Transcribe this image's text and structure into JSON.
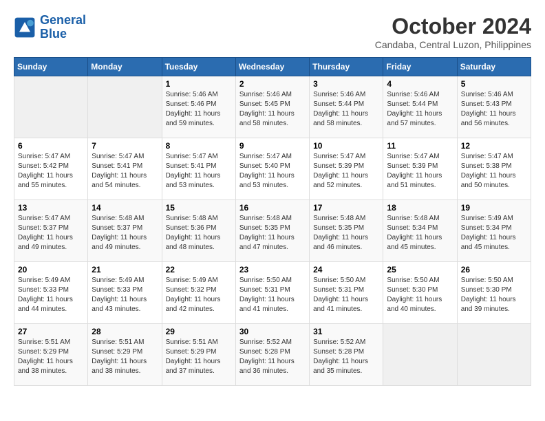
{
  "logo": {
    "line1": "General",
    "line2": "Blue"
  },
  "title": "October 2024",
  "location": "Candaba, Central Luzon, Philippines",
  "days_header": [
    "Sunday",
    "Monday",
    "Tuesday",
    "Wednesday",
    "Thursday",
    "Friday",
    "Saturday"
  ],
  "weeks": [
    [
      {
        "day": "",
        "sunrise": "",
        "sunset": "",
        "daylight": ""
      },
      {
        "day": "",
        "sunrise": "",
        "sunset": "",
        "daylight": ""
      },
      {
        "day": "1",
        "sunrise": "Sunrise: 5:46 AM",
        "sunset": "Sunset: 5:46 PM",
        "daylight": "Daylight: 11 hours and 59 minutes."
      },
      {
        "day": "2",
        "sunrise": "Sunrise: 5:46 AM",
        "sunset": "Sunset: 5:45 PM",
        "daylight": "Daylight: 11 hours and 58 minutes."
      },
      {
        "day": "3",
        "sunrise": "Sunrise: 5:46 AM",
        "sunset": "Sunset: 5:44 PM",
        "daylight": "Daylight: 11 hours and 58 minutes."
      },
      {
        "day": "4",
        "sunrise": "Sunrise: 5:46 AM",
        "sunset": "Sunset: 5:44 PM",
        "daylight": "Daylight: 11 hours and 57 minutes."
      },
      {
        "day": "5",
        "sunrise": "Sunrise: 5:46 AM",
        "sunset": "Sunset: 5:43 PM",
        "daylight": "Daylight: 11 hours and 56 minutes."
      }
    ],
    [
      {
        "day": "6",
        "sunrise": "Sunrise: 5:47 AM",
        "sunset": "Sunset: 5:42 PM",
        "daylight": "Daylight: 11 hours and 55 minutes."
      },
      {
        "day": "7",
        "sunrise": "Sunrise: 5:47 AM",
        "sunset": "Sunset: 5:41 PM",
        "daylight": "Daylight: 11 hours and 54 minutes."
      },
      {
        "day": "8",
        "sunrise": "Sunrise: 5:47 AM",
        "sunset": "Sunset: 5:41 PM",
        "daylight": "Daylight: 11 hours and 53 minutes."
      },
      {
        "day": "9",
        "sunrise": "Sunrise: 5:47 AM",
        "sunset": "Sunset: 5:40 PM",
        "daylight": "Daylight: 11 hours and 53 minutes."
      },
      {
        "day": "10",
        "sunrise": "Sunrise: 5:47 AM",
        "sunset": "Sunset: 5:39 PM",
        "daylight": "Daylight: 11 hours and 52 minutes."
      },
      {
        "day": "11",
        "sunrise": "Sunrise: 5:47 AM",
        "sunset": "Sunset: 5:39 PM",
        "daylight": "Daylight: 11 hours and 51 minutes."
      },
      {
        "day": "12",
        "sunrise": "Sunrise: 5:47 AM",
        "sunset": "Sunset: 5:38 PM",
        "daylight": "Daylight: 11 hours and 50 minutes."
      }
    ],
    [
      {
        "day": "13",
        "sunrise": "Sunrise: 5:47 AM",
        "sunset": "Sunset: 5:37 PM",
        "daylight": "Daylight: 11 hours and 49 minutes."
      },
      {
        "day": "14",
        "sunrise": "Sunrise: 5:48 AM",
        "sunset": "Sunset: 5:37 PM",
        "daylight": "Daylight: 11 hours and 49 minutes."
      },
      {
        "day": "15",
        "sunrise": "Sunrise: 5:48 AM",
        "sunset": "Sunset: 5:36 PM",
        "daylight": "Daylight: 11 hours and 48 minutes."
      },
      {
        "day": "16",
        "sunrise": "Sunrise: 5:48 AM",
        "sunset": "Sunset: 5:35 PM",
        "daylight": "Daylight: 11 hours and 47 minutes."
      },
      {
        "day": "17",
        "sunrise": "Sunrise: 5:48 AM",
        "sunset": "Sunset: 5:35 PM",
        "daylight": "Daylight: 11 hours and 46 minutes."
      },
      {
        "day": "18",
        "sunrise": "Sunrise: 5:48 AM",
        "sunset": "Sunset: 5:34 PM",
        "daylight": "Daylight: 11 hours and 45 minutes."
      },
      {
        "day": "19",
        "sunrise": "Sunrise: 5:49 AM",
        "sunset": "Sunset: 5:34 PM",
        "daylight": "Daylight: 11 hours and 45 minutes."
      }
    ],
    [
      {
        "day": "20",
        "sunrise": "Sunrise: 5:49 AM",
        "sunset": "Sunset: 5:33 PM",
        "daylight": "Daylight: 11 hours and 44 minutes."
      },
      {
        "day": "21",
        "sunrise": "Sunrise: 5:49 AM",
        "sunset": "Sunset: 5:33 PM",
        "daylight": "Daylight: 11 hours and 43 minutes."
      },
      {
        "day": "22",
        "sunrise": "Sunrise: 5:49 AM",
        "sunset": "Sunset: 5:32 PM",
        "daylight": "Daylight: 11 hours and 42 minutes."
      },
      {
        "day": "23",
        "sunrise": "Sunrise: 5:50 AM",
        "sunset": "Sunset: 5:31 PM",
        "daylight": "Daylight: 11 hours and 41 minutes."
      },
      {
        "day": "24",
        "sunrise": "Sunrise: 5:50 AM",
        "sunset": "Sunset: 5:31 PM",
        "daylight": "Daylight: 11 hours and 41 minutes."
      },
      {
        "day": "25",
        "sunrise": "Sunrise: 5:50 AM",
        "sunset": "Sunset: 5:30 PM",
        "daylight": "Daylight: 11 hours and 40 minutes."
      },
      {
        "day": "26",
        "sunrise": "Sunrise: 5:50 AM",
        "sunset": "Sunset: 5:30 PM",
        "daylight": "Daylight: 11 hours and 39 minutes."
      }
    ],
    [
      {
        "day": "27",
        "sunrise": "Sunrise: 5:51 AM",
        "sunset": "Sunset: 5:29 PM",
        "daylight": "Daylight: 11 hours and 38 minutes."
      },
      {
        "day": "28",
        "sunrise": "Sunrise: 5:51 AM",
        "sunset": "Sunset: 5:29 PM",
        "daylight": "Daylight: 11 hours and 38 minutes."
      },
      {
        "day": "29",
        "sunrise": "Sunrise: 5:51 AM",
        "sunset": "Sunset: 5:29 PM",
        "daylight": "Daylight: 11 hours and 37 minutes."
      },
      {
        "day": "30",
        "sunrise": "Sunrise: 5:52 AM",
        "sunset": "Sunset: 5:28 PM",
        "daylight": "Daylight: 11 hours and 36 minutes."
      },
      {
        "day": "31",
        "sunrise": "Sunrise: 5:52 AM",
        "sunset": "Sunset: 5:28 PM",
        "daylight": "Daylight: 11 hours and 35 minutes."
      },
      {
        "day": "",
        "sunrise": "",
        "sunset": "",
        "daylight": ""
      },
      {
        "day": "",
        "sunrise": "",
        "sunset": "",
        "daylight": ""
      }
    ]
  ]
}
